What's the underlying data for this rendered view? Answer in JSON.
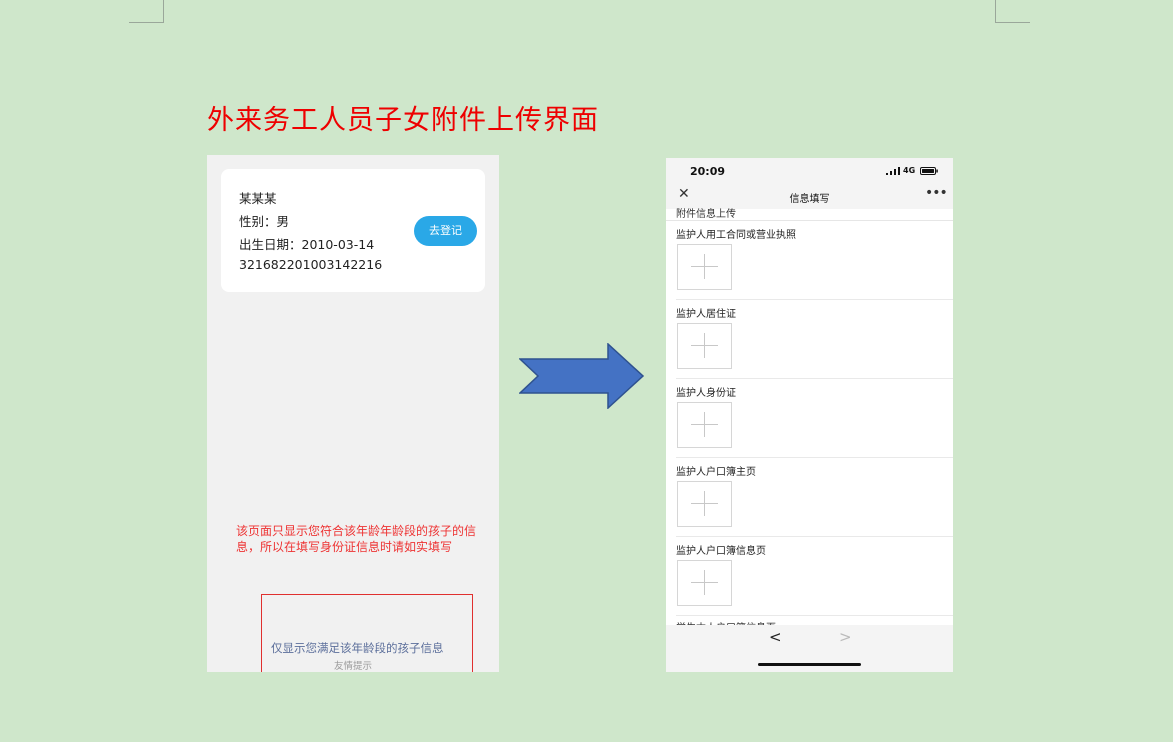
{
  "title": "外来务工人员子女附件上传界面",
  "left_screen": {
    "child_card": {
      "name": "某某某",
      "gender": "性别：男",
      "birth_date": "出生日期：2010-03-14",
      "id_number": "321682201003142216",
      "register_button": "去登记"
    },
    "note": "该页面只显示您符合该年龄年龄段的孩子的信息，所以在填写身份证信息时请如实填写",
    "hint": {
      "main": "仅显示您满足该年龄段的孩子信息",
      "sub": "友情提示"
    }
  },
  "right_screen": {
    "status_bar": {
      "time": "20:09",
      "network": "4G"
    },
    "nav": {
      "title": "信息填写",
      "close_icon": "close-icon",
      "more_icon": "more-icon"
    },
    "section_header_partial": "附件信息上传",
    "upload_items": [
      {
        "label": "监护人用工合同或营业执照"
      },
      {
        "label": "监护人居住证"
      },
      {
        "label": "监护人身份证"
      },
      {
        "label": "监护人户口簿主页"
      },
      {
        "label": "监护人户口簿信息页"
      }
    ],
    "next_item_partial": "学生本人户口簿信息页",
    "bottom_nav": {
      "back_icon": "chevron-left-icon",
      "forward_icon": "chevron-right-icon"
    }
  },
  "colors": {
    "page_bg": "#cfe7cb",
    "title_red": "#ee0000",
    "button_blue": "#2aa8e7",
    "arrow_blue": "#4472c4"
  }
}
